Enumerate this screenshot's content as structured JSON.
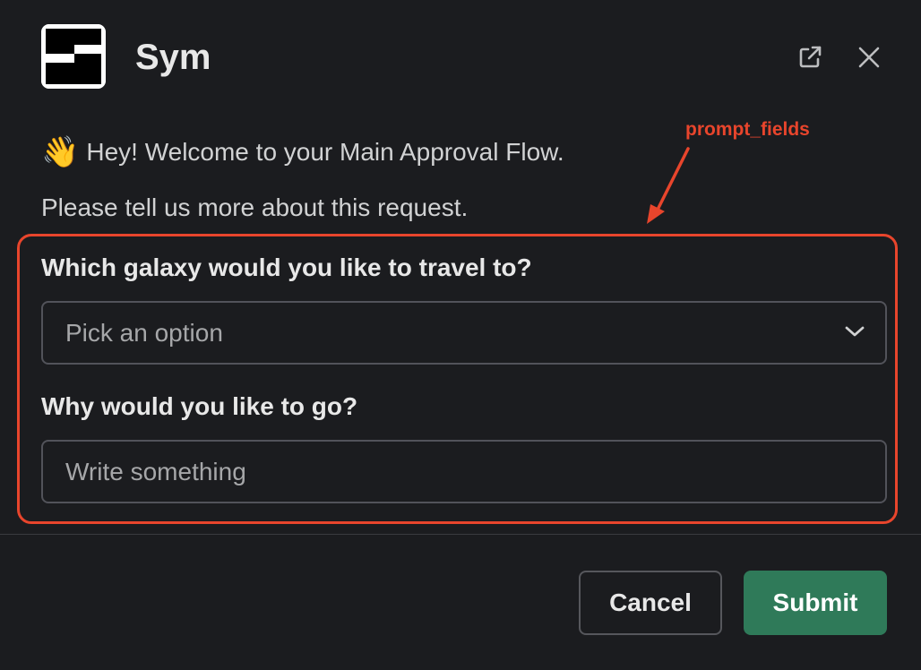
{
  "header": {
    "app_name": "Sym",
    "icons": [
      "sym-logo-icon",
      "open-external-icon",
      "close-icon"
    ]
  },
  "message": {
    "emoji": "👋",
    "welcome": "Hey! Welcome to your Main Approval Flow.",
    "subtext": "Please tell us more about this request."
  },
  "annotation": {
    "label": "prompt_fields",
    "color": "#e8452c"
  },
  "fields": {
    "galaxy": {
      "label": "Which galaxy would you like to travel to?",
      "placeholder": "Pick an option"
    },
    "reason": {
      "label": "Why would you like to go?",
      "placeholder": "Write something"
    }
  },
  "footer": {
    "cancel_label": "Cancel",
    "submit_label": "Submit",
    "submit_color": "#2f7a59"
  }
}
